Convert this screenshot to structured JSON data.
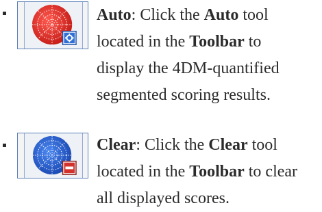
{
  "items": [
    {
      "icon": "auto-score-icon",
      "title": "Auto",
      "lines": [
        [
          "Auto",
          ": Click the ",
          "Auto",
          " tool"
        ],
        [
          "located in the ",
          "Toolbar",
          " to"
        ],
        [
          "display the 4DM-quantified"
        ],
        [
          "segmented scoring results."
        ]
      ]
    },
    {
      "icon": "clear-scores-icon",
      "title": "Clear",
      "lines": [
        [
          "Clear",
          ": Click the ",
          "Clear",
          " tool"
        ],
        [
          "located in the ",
          "Toolbar",
          " to clear"
        ],
        [
          "all displayed scores."
        ]
      ]
    }
  ],
  "colors": {
    "auto_fill": "#e8302b",
    "clear_fill": "#2e5fcf",
    "badge_blue": "#2f6fd6",
    "badge_red": "#d3322c",
    "frame": "#5a7fb8",
    "text": "#2b2b2b"
  }
}
